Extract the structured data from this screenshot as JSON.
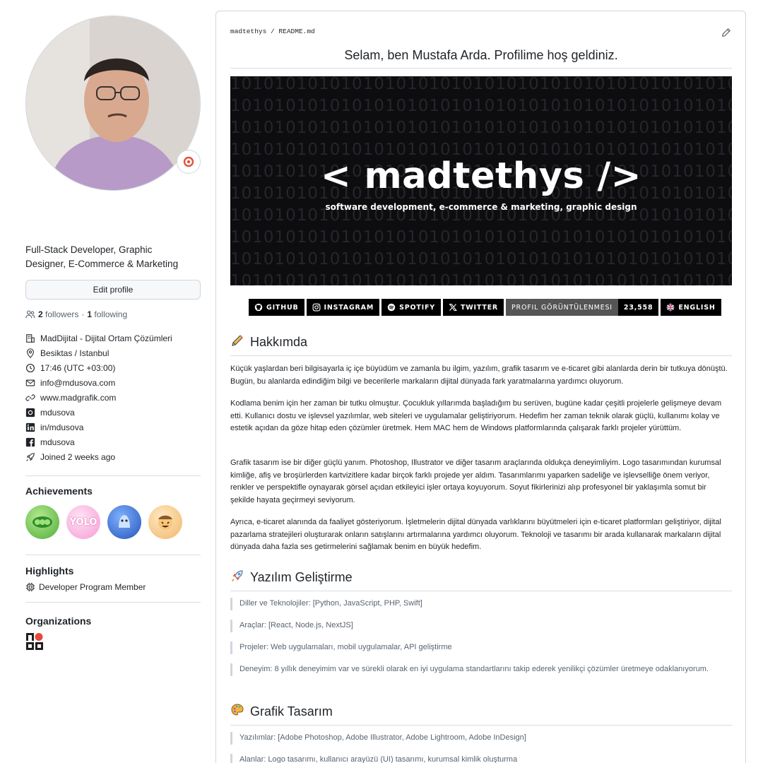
{
  "profile": {
    "bio": "Full-Stack Developer, Graphic Designer, E-Commerce & Marketing",
    "edit_label": "Edit profile",
    "followers_count": "2",
    "followers_label": "followers",
    "dot": "·",
    "following_count": "1",
    "following_label": "following",
    "details": [
      {
        "icon": "organization-icon",
        "text": "MadDijital - Dijital Ortam Çözümleri"
      },
      {
        "icon": "location-icon",
        "text": "Besiktas / Istanbul"
      },
      {
        "icon": "clock-icon",
        "text": "17:46 (UTC +03:00)"
      },
      {
        "icon": "mail-icon",
        "text": "info@mdusova.com"
      },
      {
        "icon": "link-icon",
        "text": "www.madgrafik.com"
      },
      {
        "icon": "instagram-icon",
        "text": "mdusova"
      },
      {
        "icon": "linkedin-icon",
        "text": "in/mdusova"
      },
      {
        "icon": "facebook-icon",
        "text": "mdusova"
      },
      {
        "icon": "rocket-icon",
        "text": "Joined 2 weeks ago"
      }
    ],
    "achievements_title": "Achievements",
    "achievements": [
      {
        "name": "pair-extraordinaire-badge",
        "color": "#6cc24a"
      },
      {
        "name": "yolo-badge",
        "color": "#f5a3d8",
        "label": "YOLO"
      },
      {
        "name": "quickdraw-badge",
        "color": "#3b6fd1"
      },
      {
        "name": "starstruck-badge",
        "color": "#f3c77b"
      }
    ],
    "highlights_title": "Highlights",
    "highlight": "Developer Program Member",
    "organizations_title": "Organizations"
  },
  "readme": {
    "path_user": "madtethys",
    "path_sep": " / ",
    "path_file": "README.md",
    "title": "Selam, ben Mustafa Arda. Profilime hoş geldiniz.",
    "banner_title": "< madtethys />",
    "banner_subtitle": "software development, e-commerce & marketing, graphic design",
    "banner_bits": "1010101010101010101010101010101010101010101010101010101010101010",
    "shields": {
      "github": "GITHUB",
      "instagram": "INSTAGRAM",
      "spotify": "SPOTIFY",
      "twitter": "TWITTER",
      "views_label": "PROFIL GÖRÜNTÜLENMESI",
      "views_value": "23,558",
      "english": "ENGLISH"
    },
    "about_title": "Hakkımda",
    "about_paragraphs": [
      "Küçük yaşlardan beri bilgisayarla iç içe büyüdüm ve zamanla bu ilgim, yazılım, grafik tasarım ve e-ticaret gibi alanlarda derin bir tutkuya dönüştü. Bugün, bu alanlarda edindiğim bilgi ve becerilerle markaların dijital dünyada fark yaratmalarına yardımcı oluyorum.",
      "Kodlama benim için her zaman bir tutku olmuştur. Çocukluk yıllarımda başladığım bu serüven, bugüne kadar çeşitli projelerle gelişmeye devam etti. Kullanıcı dostu ve işlevsel yazılımlar, web siteleri ve uygulamalar geliştiriyorum. Hedefim her zaman teknik olarak güçlü, kullanımı kolay ve estetik açıdan da göze hitap eden çözümler üretmek. Hem MAC hem de Windows platformlarında çalışarak farklı projeler yürüttüm.",
      "Grafik tasarım ise bir diğer güçlü yanım. Photoshop, Illustrator ve diğer tasarım araçlarında oldukça deneyimliyim. Logo tasarımından kurumsal kimliğe, afiş ve broşürlerden kartvizitlere kadar birçok farklı projede yer aldım. Tasarımlarımı yaparken sadeliğe ve işlevselliğe önem veriyor, renkler ve perspektifle oynayarak görsel açıdan etkileyici işler ortaya koyuyorum. Soyut fikirlerinizi alıp profesyonel bir yaklaşımla somut bir şekilde hayata geçirmeyi seviyorum.",
      "Ayrıca, e-ticaret alanında da faaliyet gösteriyorum. İşletmelerin dijital dünyada varlıklarını büyütmeleri için e-ticaret platformları geliştiriyor, dijital pazarlama stratejileri oluşturarak onların satışlarını artırmalarına yardımcı oluyorum. Teknoloji ve tasarımı bir arada kullanarak markaların dijital dünyada daha fazla ses getirmelerini sağlamak benim en büyük hedefim."
    ],
    "software_title": "Yazılım Geliştirme",
    "software_items": [
      "Diller ve Teknolojiler: [Python, JavaScript, PHP, Swift]",
      "Araçlar: [React, Node.js, NextJS]",
      "Projeler: Web uygulamaları, mobil uygulamalar, API geliştirme",
      "Deneyim: 8 yıllık deneyimim var ve sürekli olarak en iyi uygulama standartlarını takip ederek yenilikçi çözümler üretmeye odaklanıyorum."
    ],
    "design_title": "Grafik Tasarım",
    "design_items": [
      "Yazılımlar: [Adobe Photoshop, Adobe Illustrator, Adobe Lightroom, Adobe InDesign]",
      "Alanlar: Logo tasarımı, kullanıcı arayüzü (UI) tasarımı, kurumsal kimlik oluşturma"
    ]
  }
}
